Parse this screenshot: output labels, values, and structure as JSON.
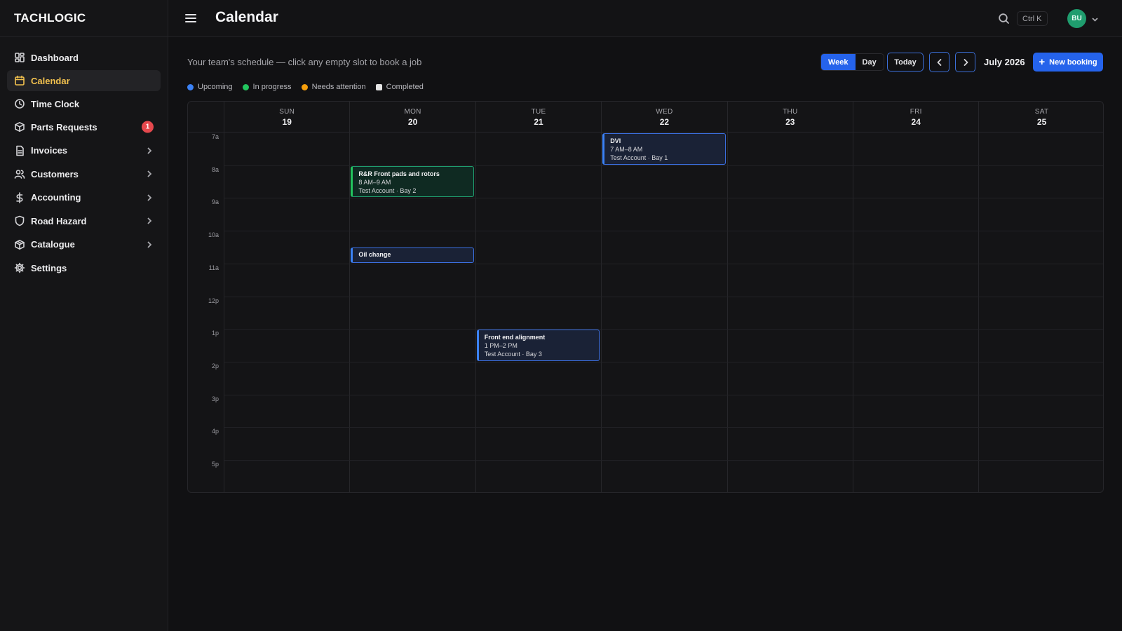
{
  "brand": "TACHLOGIC",
  "sidebar": {
    "items": [
      {
        "label": "Dashboard",
        "icon": "dashboard-icon"
      },
      {
        "label": "Calendar",
        "icon": "calendar-icon",
        "active": true
      },
      {
        "label": "Time Clock",
        "icon": "clock-icon"
      },
      {
        "label": "Parts Requests",
        "icon": "package-icon",
        "badge": "1"
      },
      {
        "label": "Invoices",
        "icon": "file-icon",
        "chevron": true
      },
      {
        "label": "Customers",
        "icon": "users-icon",
        "chevron": true
      },
      {
        "label": "Accounting",
        "icon": "dollar-icon",
        "chevron": true
      },
      {
        "label": "Road Hazard",
        "icon": "shield-icon",
        "chevron": true
      },
      {
        "label": "Catalogue",
        "icon": "box-icon",
        "chevron": true
      },
      {
        "label": "Settings",
        "icon": "gear-icon"
      }
    ]
  },
  "header": {
    "title": "Calendar",
    "shortcut": "Ctrl K",
    "avatar": "BU"
  },
  "main": {
    "subtitle": "Your team's schedule — click any empty slot to book a job",
    "legend": [
      {
        "label": "Upcoming",
        "color": "#3b82f6"
      },
      {
        "label": "In progress",
        "color": "#22c55e"
      },
      {
        "label": "Needs attention",
        "color": "#f59e0b"
      },
      {
        "label": "Completed",
        "color": "#e5e5e5"
      }
    ],
    "view_week": "Week",
    "view_day": "Day",
    "today": "Today",
    "month": "July 2026",
    "new_booking": "New booking"
  },
  "calendar": {
    "days": [
      {
        "name": "SUN",
        "num": "19"
      },
      {
        "name": "MON",
        "num": "20"
      },
      {
        "name": "TUE",
        "num": "21"
      },
      {
        "name": "WED",
        "num": "22"
      },
      {
        "name": "THU",
        "num": "23"
      },
      {
        "name": "FRI",
        "num": "24"
      },
      {
        "name": "SAT",
        "num": "25"
      }
    ],
    "hours": [
      "7a",
      "8a",
      "9a",
      "10a",
      "11a",
      "12p",
      "1p",
      "2p",
      "3p",
      "4p",
      "5p"
    ],
    "events": [
      {
        "title": "DVI",
        "time": "7 AM–8 AM",
        "meta": "Test Account · Bay 1",
        "status": "upcoming"
      },
      {
        "title": "R&R Front pads and rotors",
        "time": "8 AM–9 AM",
        "meta": "Test Account · Bay 2",
        "status": "progress"
      },
      {
        "title": "Oil change",
        "time": "",
        "meta": "",
        "status": "upcoming"
      },
      {
        "title": "Front end alignment",
        "time": "1 PM–2 PM",
        "meta": "Test Account · Bay 3",
        "status": "upcoming"
      }
    ]
  },
  "colors": {
    "accent": "#2563eb",
    "active_nav": "#f2c14e",
    "badge": "#e5484d",
    "avatar": "#1f9d6e"
  }
}
